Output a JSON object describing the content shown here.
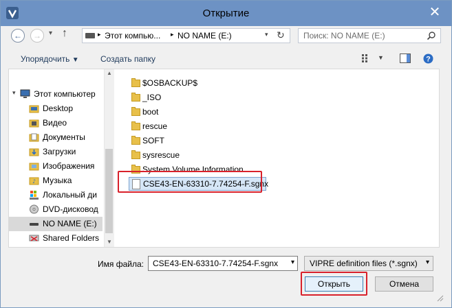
{
  "window": {
    "title": "Открытие"
  },
  "address": {
    "computer": "Этот компью...",
    "drive": "NO NAME (E:)"
  },
  "search": {
    "placeholder": "Поиск: NO NAME (E:)"
  },
  "toolbar": {
    "organize": "Упорядочить",
    "new_folder": "Создать папку"
  },
  "tree": {
    "items": [
      {
        "label": "Этот компьютер",
        "icon": "computer-icon"
      },
      {
        "label": "Desktop",
        "icon": "desktop-folder-icon"
      },
      {
        "label": "Видео",
        "icon": "video-folder-icon"
      },
      {
        "label": "Документы",
        "icon": "documents-folder-icon"
      },
      {
        "label": "Загрузки",
        "icon": "downloads-folder-icon"
      },
      {
        "label": "Изображения",
        "icon": "pictures-folder-icon"
      },
      {
        "label": "Музыка",
        "icon": "music-folder-icon"
      },
      {
        "label": "Локальный ди",
        "icon": "local-disk-icon"
      },
      {
        "label": "DVD-дисковод",
        "icon": "dvd-drive-icon"
      },
      {
        "label": "NO NAME (E:)",
        "icon": "usb-drive-icon"
      },
      {
        "label": "Shared Folders",
        "icon": "network-drive-icon"
      }
    ]
  },
  "files": {
    "items": [
      {
        "label": "$OSBACKUP$",
        "icon": "folder-icon"
      },
      {
        "label": "_ISO",
        "icon": "folder-icon"
      },
      {
        "label": "boot",
        "icon": "folder-icon"
      },
      {
        "label": "rescue",
        "icon": "folder-icon"
      },
      {
        "label": "SOFT",
        "icon": "folder-icon"
      },
      {
        "label": "sysrescue",
        "icon": "folder-icon"
      },
      {
        "label": "System Volume Information",
        "icon": "folder-icon"
      },
      {
        "label": "CSE43-EN-63310-7.74254-F.sgnx",
        "icon": "file-icon"
      }
    ]
  },
  "bottom": {
    "filename_label": "Имя файла:",
    "filename_value": "CSE43-EN-63310-7.74254-F.sgnx",
    "filetype_value": "VIPRE definition files (*.sgnx)",
    "open_button": "Открыть",
    "cancel_button": "Отмена"
  },
  "colors": {
    "titlebar": "#6d92c4",
    "highlight": "#d8202a",
    "selection": "#d5e6f7"
  }
}
